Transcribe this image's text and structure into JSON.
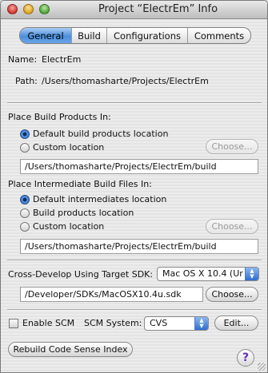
{
  "window": {
    "title": "Project “ElectrEm” Info"
  },
  "tabs": [
    {
      "label": "General",
      "selected": true
    },
    {
      "label": "Build",
      "selected": false
    },
    {
      "label": "Configurations",
      "selected": false
    },
    {
      "label": "Comments",
      "selected": false
    }
  ],
  "general": {
    "name_label": "Name:",
    "name_value": "ElectrEm",
    "path_label": "Path:",
    "path_value": "/Users/thomasharte/Projects/ElectrEm"
  },
  "build_products": {
    "heading": "Place Build Products In:",
    "option_default": "Default build products location",
    "option_custom": "Custom location",
    "selected": "Default build products location",
    "choose_label": "Choose...",
    "path_value": "/Users/thomasharte/Projects/ElectrEm/build"
  },
  "intermediate": {
    "heading": "Place Intermediate Build Files In:",
    "option_default": "Default intermediates location",
    "option_products": "Build products location",
    "option_custom": "Custom location",
    "selected": "Default intermediates location",
    "choose_label": "Choose...",
    "path_value": "/Users/thomasharte/Projects/ElectrEm/build"
  },
  "sdk": {
    "label": "Cross-Develop Using Target SDK:",
    "selected": "Mac OS X 10.4 (Ur",
    "path_value": "/Developer/SDKs/MacOSX10.4u.sdk",
    "choose_label": "Choose..."
  },
  "scm": {
    "enable_label": "Enable SCM",
    "enabled": false,
    "system_label": "SCM System:",
    "system_value": "CVS",
    "edit_label": "Edit..."
  },
  "rebuild_label": "Rebuild Code Sense Index",
  "help_glyph": "?",
  "icons": {
    "close": "close-button",
    "minimize": "minimize-button",
    "zoom": "zoom-button",
    "help": "help-icon",
    "resize": "resize-grip-icon"
  }
}
